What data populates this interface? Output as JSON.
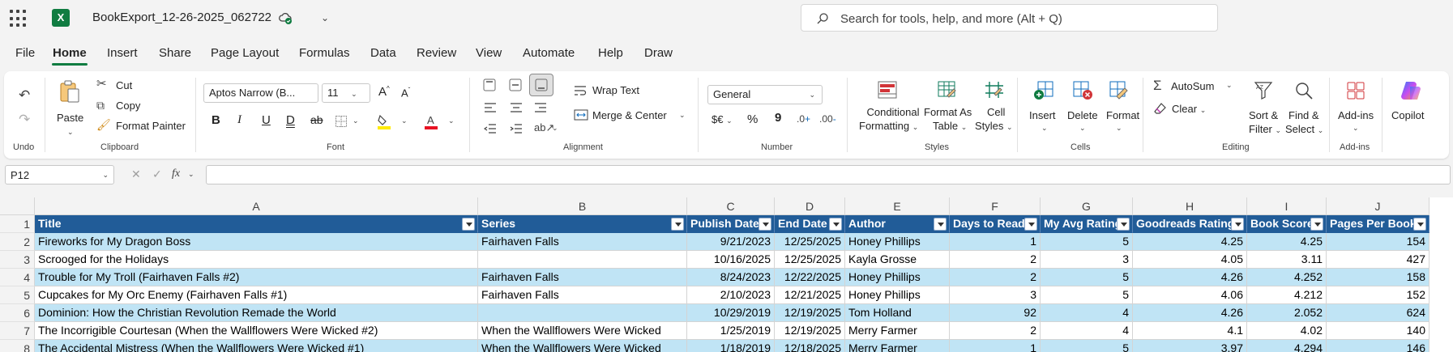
{
  "titlebar": {
    "app_icon": "excel-icon",
    "app_letter": "X",
    "file_name": "BookExport_12-26-2025_062722",
    "search_placeholder": "Search for tools, help, and more (Alt + Q)"
  },
  "menu": [
    "File",
    "Home",
    "Insert",
    "Share",
    "Page Layout",
    "Formulas",
    "Data",
    "Review",
    "View",
    "Automate",
    "Help",
    "Draw"
  ],
  "ribbon": {
    "undo_label": "Undo",
    "clipboard": {
      "label": "Clipboard",
      "paste": "Paste",
      "cut": "Cut",
      "copy": "Copy",
      "format_painter": "Format Painter"
    },
    "font": {
      "label": "Font",
      "name": "Aptos Narrow (B...",
      "size": "11",
      "grow": "A",
      "shrink": "A"
    },
    "alignment": {
      "label": "Alignment",
      "wrap_text": "Wrap Text",
      "merge_center": "Merge & Center"
    },
    "number": {
      "label": "Number",
      "format": "General",
      "currency": "$€",
      "percent": "%",
      "comma": "9"
    },
    "styles": {
      "label": "Styles",
      "conditional_1": "Conditional",
      "conditional_2": "Formatting",
      "table_1": "Format As",
      "table_2": "Table",
      "cell_1": "Cell",
      "cell_2": "Styles"
    },
    "cells": {
      "label": "Cells",
      "insert": "Insert",
      "delete": "Delete",
      "format": "Format"
    },
    "editing": {
      "label": "Editing",
      "autosum": "AutoSum",
      "clear": "Clear",
      "sort_1": "Sort &",
      "sort_2": "Filter",
      "find_1": "Find &",
      "find_2": "Select"
    },
    "addins": {
      "label": "Add-ins",
      "button": "Add-ins"
    },
    "copilot": {
      "button": "Copilot"
    }
  },
  "formula_bar": {
    "name_box": "P12",
    "fx": "fx",
    "content": ""
  },
  "sheet": {
    "columns": [
      "A",
      "B",
      "C",
      "D",
      "E",
      "F",
      "G",
      "H",
      "I",
      "J"
    ],
    "headers": [
      "Title",
      "Series",
      "Publish Date",
      "End Date",
      "Author",
      "Days to Read",
      "My Avg Rating",
      "Goodreads Rating",
      "Book Score",
      "Pages Per Book"
    ],
    "row_numbers": [
      "1",
      "2",
      "3",
      "4",
      "5",
      "6",
      "7",
      "8"
    ],
    "rows": [
      [
        "Fireworks for My Dragon Boss",
        "Fairhaven Falls",
        "9/21/2023",
        "12/25/2025",
        "Honey Phillips",
        "1",
        "5",
        "4.25",
        "4.25",
        "154"
      ],
      [
        "Scrooged for the Holidays",
        "",
        "10/16/2025",
        "12/25/2025",
        "Kayla Grosse",
        "2",
        "3",
        "4.05",
        "3.11",
        "427"
      ],
      [
        "Trouble for My Troll (Fairhaven Falls #2)",
        "Fairhaven Falls",
        "8/24/2023",
        "12/22/2025",
        "Honey Phillips",
        "2",
        "5",
        "4.26",
        "4.252",
        "158"
      ],
      [
        "Cupcakes for My Orc Enemy (Fairhaven Falls #1)",
        "Fairhaven Falls",
        "2/10/2023",
        "12/21/2025",
        "Honey Phillips",
        "3",
        "5",
        "4.06",
        "4.212",
        "152"
      ],
      [
        "Dominion: How the Christian Revolution Remade the World",
        "",
        "10/29/2019",
        "12/19/2025",
        "Tom Holland",
        "92",
        "4",
        "4.26",
        "2.052",
        "624"
      ],
      [
        "The Incorrigible Courtesan (When the Wallflowers Were Wicked #2)",
        "When the Wallflowers Were Wicked",
        "1/25/2019",
        "12/19/2025",
        "Merry Farmer",
        "2",
        "4",
        "4.1",
        "4.02",
        "140"
      ],
      [
        "The Accidental Mistress (When the Wallflowers Were Wicked #1)",
        "When the Wallflowers Were Wicked",
        "1/18/2019",
        "12/18/2025",
        "Merry Farmer",
        "1",
        "5",
        "3.97",
        "4.294",
        "146"
      ]
    ]
  },
  "colors": {
    "accent": "#107c41",
    "table_header": "#215c98",
    "band": "#c0e4f5"
  }
}
